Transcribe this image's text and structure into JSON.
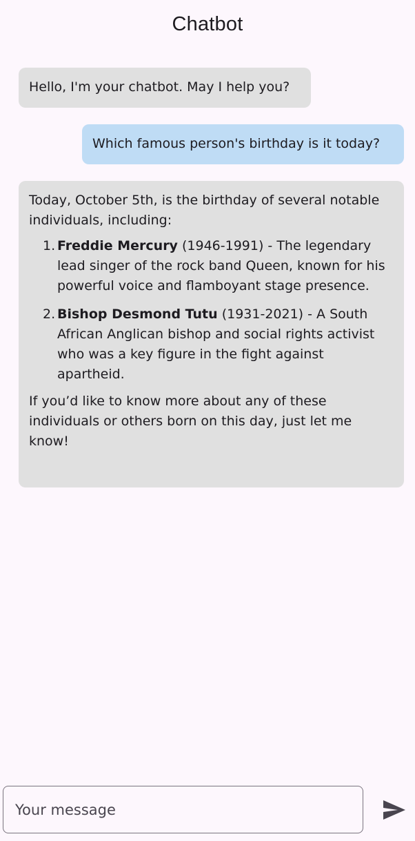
{
  "app_bar": {
    "title": "Chatbot"
  },
  "messages": [
    {
      "sender": "bot",
      "text": "Hello, I'm your chatbot. May I help you?"
    },
    {
      "sender": "user",
      "text": "Which famous person's birthday is it today?"
    },
    {
      "sender": "bot",
      "intro": "Today, October 5th, is the birthday of several notable individuals, including:",
      "items": [
        {
          "number": "1.",
          "name": "Freddie Mercury",
          "details": " (1946-1991) - The legendary lead singer of the rock band Queen, known for his powerful voice and flamboyant stage presence."
        },
        {
          "number": "2.",
          "name": "Bishop Desmond Tutu",
          "details": " (1931-2021) - A South African Anglican bishop and social rights activist who was a key figure in the fight against apartheid."
        }
      ],
      "outro": "If you’d like to know more about any of these individuals or others born on this day, just let me know!"
    }
  ],
  "composer": {
    "placeholder": "Your message",
    "value": "",
    "send_icon": "send-icon"
  },
  "colors": {
    "background": "#fdf7fd",
    "bot_bubble": "#e0e0e0",
    "user_bubble": "#bfdcf5",
    "send_icon": "#49454f"
  }
}
